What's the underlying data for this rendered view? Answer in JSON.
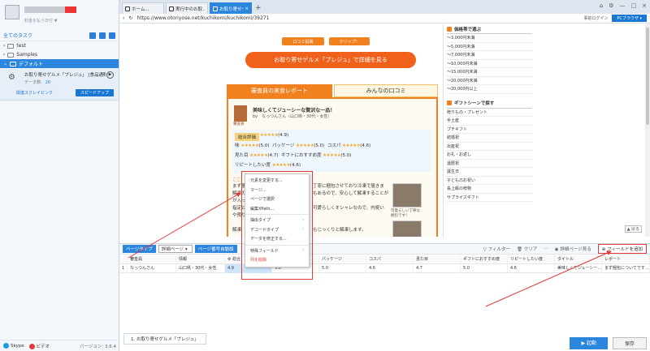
{
  "sidebar": {
    "user_sub": "料金を払う日付 ▼",
    "task_header": "全てのタスク",
    "tree": [
      {
        "label": "test",
        "selected": false
      },
      {
        "label": "Samples",
        "selected": false
      },
      {
        "label": "デフォルト",
        "selected": true
      }
    ],
    "task": {
      "name": "お取り寄せゲルメ「プレジュ」 [食品通販",
      "count_label": "データ数:",
      "count_value": "20",
      "crawl_label": "関連スクレイピング",
      "speedup_label": "スピードアップ"
    },
    "footer": {
      "skype": "Skype",
      "video": "ビデオ",
      "version": "バージョン: 3.6.4"
    }
  },
  "browser": {
    "tabs": [
      {
        "label": "ホーム...",
        "active": false
      },
      {
        "label": "実行中のお取...",
        "active": false
      },
      {
        "label": "お取り寄せゲ...",
        "active": true
      }
    ],
    "url": "https://www.otoriyose.net/kuchikomi/kuchikomi/39271",
    "login_label": "事前ログイン",
    "pc_browser_label": "PCブラウザ"
  },
  "webpage": {
    "btn_kuchikomi": "口コミ投稿",
    "btn_clip": "クリップ！",
    "big_button": "お取り寄せゲルメ「プレジュ」で詳細を見る",
    "tab_report": "審査員の実食レポート",
    "tab_reviews": "みんなの口コミ",
    "reviewer_tag": "審査員",
    "review_title": "美味しくてジューシーな贅沢な一品！",
    "review_by": "by　なっつんさん（山口県・30代・女性）",
    "total_label": "総合評価",
    "total_stars": "★★★★★",
    "total_score": "(4.9)",
    "ratings": [
      {
        "label": "味",
        "stars": "★★★★★",
        "score": "(5.0)"
      },
      {
        "label": "パッケージ",
        "stars": "★★★★★",
        "score": "(5.0)"
      },
      {
        "label": "コスパ",
        "stars": "★★★★★",
        "score": "(4.6)"
      },
      {
        "label": "見た目",
        "stars": "★★★★★",
        "score": "(4.7)"
      },
      {
        "label": "ギフトにおすすめ度",
        "stars": "★★★★★",
        "score": "(5.0)"
      },
      {
        "label": "リピートしたい度",
        "stars": "★★★★★",
        "score": "(4.6)"
      }
    ],
    "link_here": "ここ",
    "body_lines": [
      "まず梱",
      "解凍の",
      "が入っ",
      "指定と",
      "や預り",
      "解凍"
    ],
    "body_right": [
      "丁寧に梱包させており冷凍で届きま",
      "もあるので、安心して解凍することが",
      "可愛らしくオシャレなので、内祝い",
      "もじっくりと解凍します。"
    ],
    "photo_caption": "可愛らしい丁寧な梱包です！",
    "right_col": {
      "price_head": "価格帯で選ぶ",
      "prices": [
        "〜3,000円未満",
        "〜5,000円未満",
        "〜7,000円未満",
        "〜10,000円未満",
        "〜15,000円未満",
        "〜20,000円未満",
        "〜20,000円以上"
      ],
      "gift_head": "ギフトシーンで探す",
      "gifts": [
        "贈りもの・プレゼント",
        "手土産",
        "プチギフト",
        "結婚祝",
        "出産祝",
        "お礼・お返し",
        "還暦祝",
        "誕生日",
        "子どものお祝い",
        "長上級の贈物",
        "サプライズギフト"
      ],
      "to_top": "▲ 戻る"
    }
  },
  "context_menu": {
    "items": [
      {
        "label": "元素を変更する...",
        "submenu": false,
        "danger": false
      },
      {
        "label": "マージ...",
        "submenu": false,
        "danger": false
      },
      {
        "label": "ページで選択",
        "submenu": false,
        "danger": false
      },
      {
        "label": "編集XPath...",
        "submenu": false,
        "danger": false
      },
      {
        "label": "抽出タイプ",
        "submenu": true,
        "danger": false
      },
      {
        "label": "デコードタイプ",
        "submenu": true,
        "danger": false
      },
      {
        "label": "データを修正する...",
        "submenu": false,
        "danger": false
      },
      {
        "label": "特殊フィールド",
        "submenu": true,
        "danger": false
      },
      {
        "label": "列を削除",
        "submenu": false,
        "danger": true
      }
    ]
  },
  "data_panel": {
    "page_type_label": "ページタイプ",
    "page_type_value": "詳細ページ",
    "page_num_label": "ページ番号自動設",
    "filter": "フィルター",
    "clear": "クリア",
    "details": "詳細ページ見る",
    "add_field": "⊕ フィールドを追加",
    "columns": [
      "",
      "審査員",
      "情報",
      "総合",
      "味",
      "パッケージ",
      "コスパ",
      "見た目",
      "ギフトにおすすめ度",
      "リピートしたい度",
      "タイトル",
      "レポート"
    ],
    "rows": [
      [
        "1",
        "なっつんさん",
        "山口県・30代・女性",
        "4.9",
        "5.0",
        "5.0",
        "4.6",
        "4.7",
        "5.0",
        "4.6",
        "美味しくてジューシー...",
        "まず梱包についてです..."
      ]
    ]
  },
  "footer": {
    "task_tab": "1. お取り寄せゲルメ「プレジュ」",
    "start": "▶ 起動",
    "save": "保存"
  },
  "colors": {
    "accent": "#2d86de",
    "orange": "#f1801f",
    "red": "#e23a3a"
  }
}
